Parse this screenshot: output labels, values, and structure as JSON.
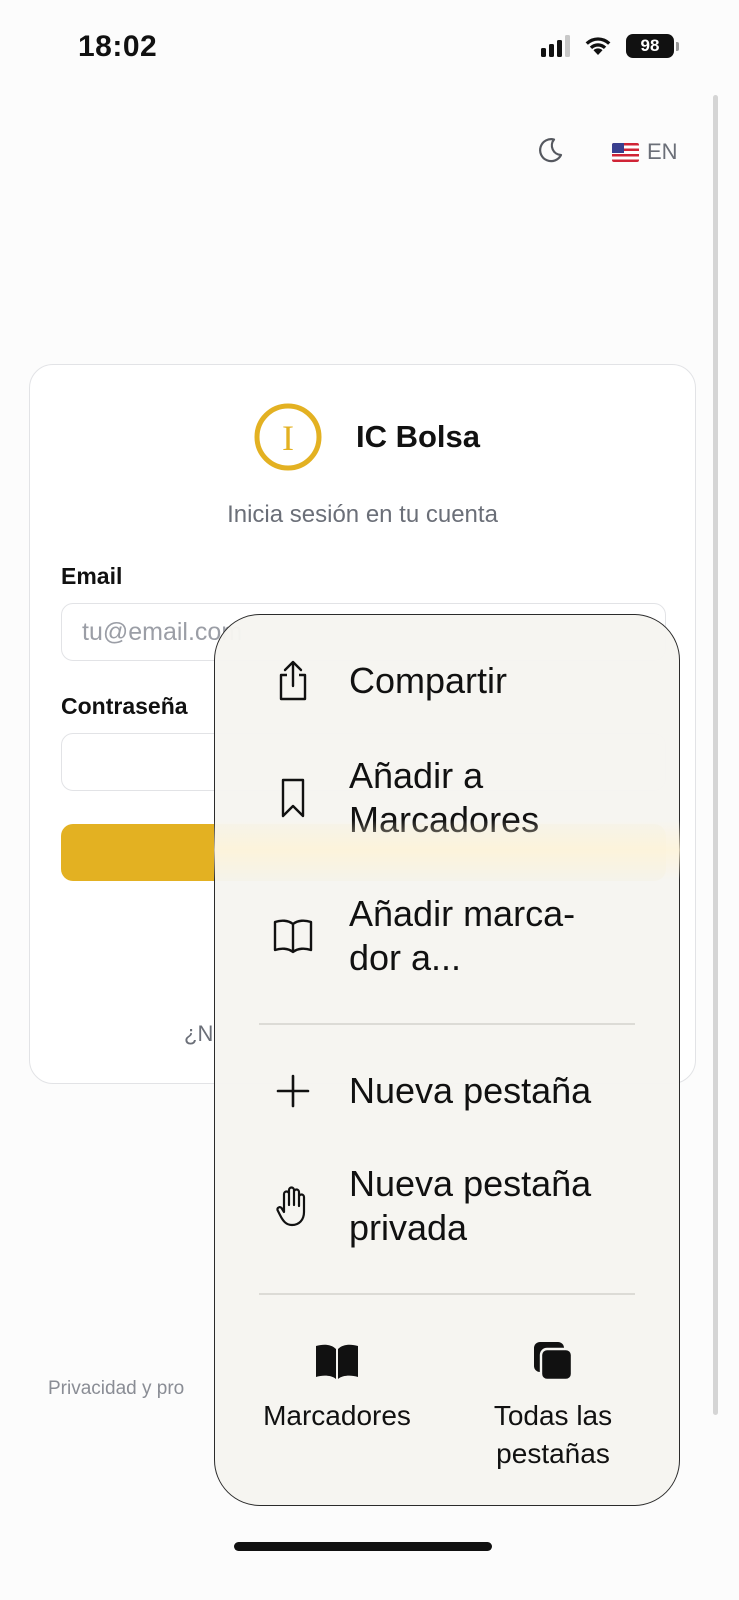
{
  "status_bar": {
    "time": "18:02",
    "battery": "98",
    "icons": [
      "signal-icon",
      "wifi-icon",
      "battery-icon"
    ]
  },
  "header": {
    "theme_icon": "moon-icon",
    "language": {
      "flag_icon": "us-flag-icon",
      "label": "EN"
    }
  },
  "login": {
    "brand_name": "IC Bolsa",
    "brand_logo": "ic-bolsa-logo",
    "subtitle": "Inicia sesión en tu cuenta",
    "email_label": "Email",
    "email_placeholder": "tu@email.com",
    "password_label": "Contraseña",
    "signup_prompt_partial": "¿N",
    "accent_color": "#e3b122"
  },
  "footer": {
    "privacy_partial": "Privacidad y pro"
  },
  "context_menu": {
    "items": [
      {
        "label": "Compartir",
        "icon": "share-icon"
      },
      {
        "label": "Añadir a\nMarcadores",
        "icon": "bookmark-icon"
      },
      {
        "label": "Añadir marca-\ndor a...",
        "icon": "open-book-icon"
      },
      {
        "label": "Nueva pestaña",
        "icon": "plus-icon"
      },
      {
        "label": "Nueva pestaña\nprivada",
        "icon": "hand-icon"
      }
    ],
    "actions": [
      {
        "label": "Marcadores",
        "icon": "bookmarks-book-icon"
      },
      {
        "label": "Todas las\npestañas",
        "icon": "tabs-icon"
      }
    ]
  }
}
